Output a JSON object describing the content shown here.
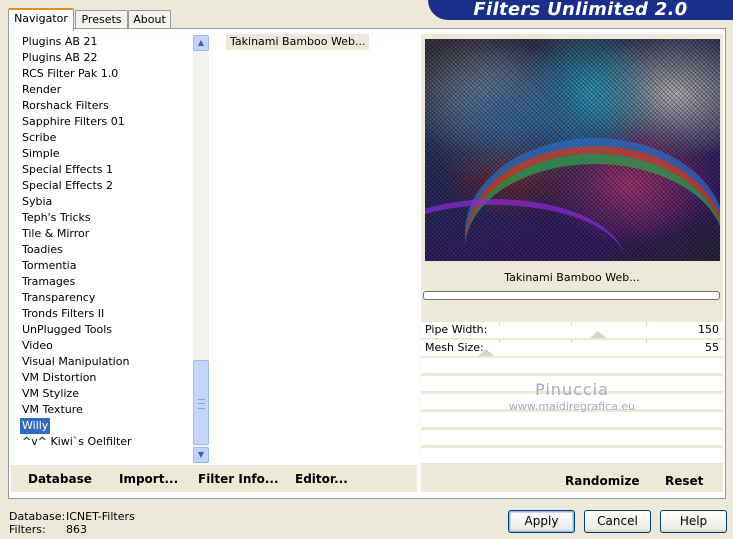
{
  "banner": {
    "title": "Filters Unlimited 2.0"
  },
  "tabs": [
    {
      "label": "Navigator",
      "active": true
    },
    {
      "label": "Presets",
      "active": false
    },
    {
      "label": "About",
      "active": false
    }
  ],
  "filter_list": {
    "items": [
      "Plugins AB 21",
      "Plugins AB 22",
      "RCS Filter Pak 1.0",
      "Render",
      "Rorshack Filters",
      "Sapphire Filters 01",
      "Scribe",
      "Simple",
      "Special Effects 1",
      "Special Effects 2",
      "Sybia",
      "Teph's Tricks",
      "Tile & Mirror",
      "Toadies",
      "Tormentia",
      "Tramages",
      "Transparency",
      "Tronds Filters II",
      "UnPlugged Tools",
      "Video",
      "Visual Manipulation",
      "VM Distortion",
      "VM Stylize",
      "VM Texture",
      "Willy",
      "^v^ Kiwi`s Oelfilter"
    ],
    "selected": "Willy"
  },
  "effects_list": {
    "items": [
      "Takinami Bamboo Web..."
    ]
  },
  "left_buttons": {
    "database": "Database",
    "import": "Import...",
    "filter_info": "Filter Info...",
    "editor": "Editor..."
  },
  "preview": {
    "filter_name": "Takinami Bamboo Web..."
  },
  "params": [
    {
      "label": "Pipe Width:",
      "value": "150"
    },
    {
      "label": "Mesh Size:",
      "value": "55"
    }
  ],
  "watermark": {
    "line1": "Pinuccia",
    "line2": "www.maidiregrafica.eu"
  },
  "right_buttons": {
    "randomize": "Randomize",
    "reset": "Reset"
  },
  "footer": {
    "database_label": "Database:",
    "database_value": "ICNET-Filters",
    "filters_label": "Filters:",
    "filters_value": "863"
  },
  "dialog_buttons": {
    "apply": "Apply",
    "cancel": "Cancel",
    "help": "Help"
  }
}
